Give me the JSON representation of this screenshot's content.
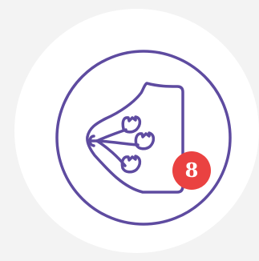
{
  "icon": {
    "name": "breast-anatomy-icon",
    "stroke_color": "#5e4ba0",
    "disc_color": "#ffffff",
    "background_color": "#f3f3f3"
  },
  "badge": {
    "value": "8",
    "color": "#ea4241"
  }
}
